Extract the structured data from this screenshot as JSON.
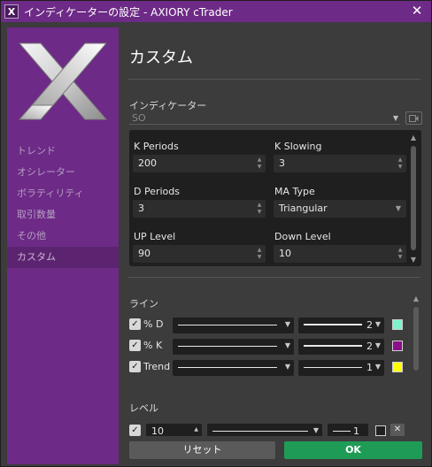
{
  "window": {
    "title": "インディケーターの設定 - AXIORY cTrader",
    "app_icon_letter": "X",
    "close_symbol": "✕"
  },
  "sidebar": {
    "items": [
      {
        "label": "トレンド",
        "active": false
      },
      {
        "label": "オシレーター",
        "active": false
      },
      {
        "label": "ボラティリティ",
        "active": false
      },
      {
        "label": "取引数量",
        "active": false
      },
      {
        "label": "その他",
        "active": false
      },
      {
        "label": "カスタム",
        "active": true
      }
    ]
  },
  "main": {
    "title": "カスタム",
    "indicator_label": "インディケーター",
    "indicator_value": "SO",
    "params": {
      "k_periods": {
        "label": "K Periods",
        "value": "200"
      },
      "k_slowing": {
        "label": "K Slowing",
        "value": "3"
      },
      "d_periods": {
        "label": "D Periods",
        "value": "3"
      },
      "ma_type": {
        "label": "MA Type",
        "value": "Triangular"
      },
      "up_level": {
        "label": "UP Level",
        "value": "90"
      },
      "down_level": {
        "label": "Down Level",
        "value": "10"
      }
    },
    "lines_label": "ライン",
    "lines": [
      {
        "label": "% D",
        "checked": true,
        "thickness": "2",
        "color": "#7ef2c8"
      },
      {
        "label": "% K",
        "checked": true,
        "thickness": "2",
        "color": "#8b0f8b"
      },
      {
        "label": "Trend",
        "checked": true,
        "thickness": "1",
        "color": "#ffff00"
      }
    ],
    "levels_label": "レベル",
    "levels": [
      {
        "checked": true,
        "value": "10",
        "thickness": "1",
        "color": "#202020"
      }
    ]
  },
  "buttons": {
    "reset": "リセット",
    "ok": "OK"
  },
  "colors": {
    "accent": "#6d2a86",
    "ok_green": "#1e9c56"
  }
}
